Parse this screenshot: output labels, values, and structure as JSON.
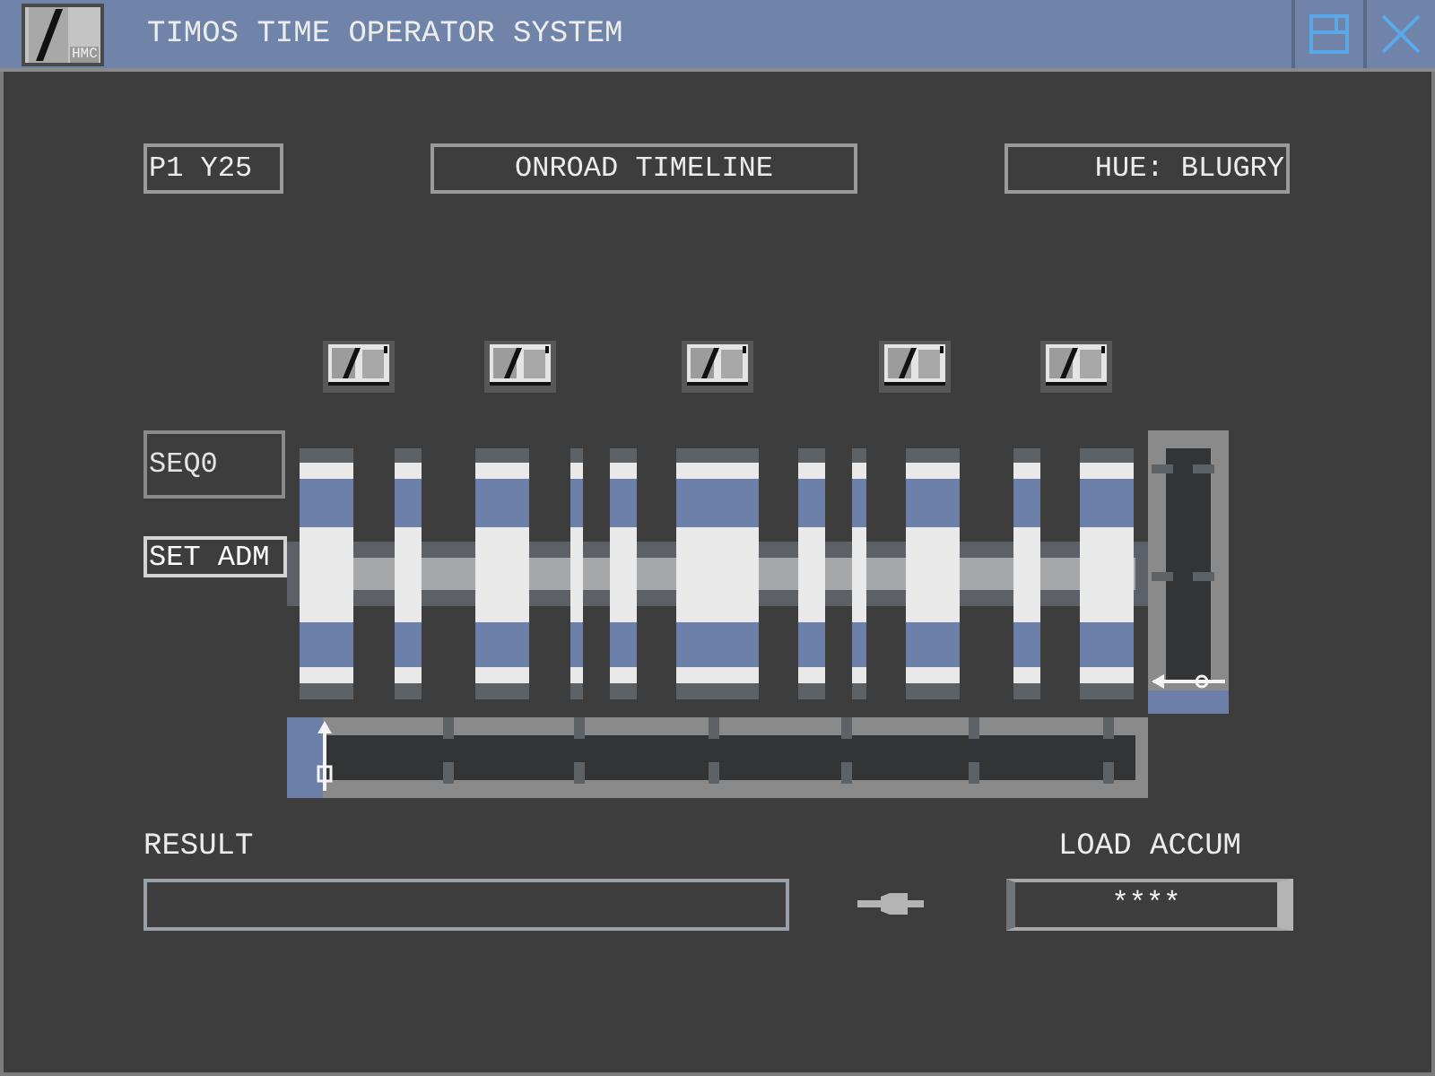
{
  "window": {
    "title": "TIMOS TIME OPERATOR SYSTEM",
    "logo_text": "HMC"
  },
  "header": {
    "page": "P1 Y25",
    "view_title": "ONROAD TIMELINE",
    "hue": "HUE: BLUGRY"
  },
  "timeline": {
    "row_labels": [
      {
        "text": "SEQ0",
        "selected": false
      },
      {
        "text": "SET ADM",
        "selected": true
      }
    ]
  },
  "result": {
    "label": "RESULT"
  },
  "load_accum": {
    "label": "LOAD ACCUM",
    "value": "****"
  }
}
